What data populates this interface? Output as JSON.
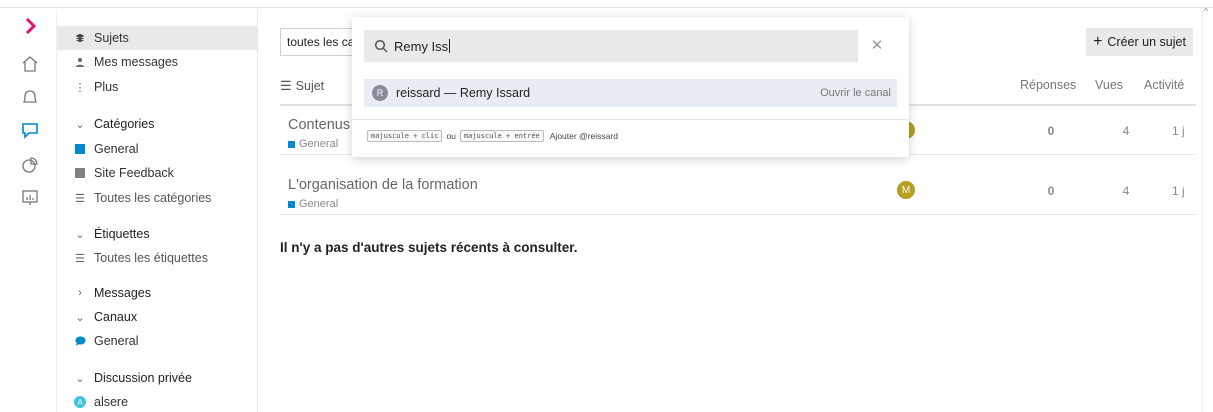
{
  "rail": {
    "items": [
      {
        "name": "expand-chevron-icon"
      },
      {
        "name": "home-icon"
      },
      {
        "name": "bell-icon"
      },
      {
        "name": "chat-icon"
      },
      {
        "name": "pie-chart-icon"
      },
      {
        "name": "presentation-icon"
      }
    ],
    "accent": "#e2136e",
    "active_color": "#0088cc"
  },
  "sidebar": {
    "sujets": "Sujets",
    "mes_messages": "Mes messages",
    "plus": "Plus",
    "categories_head": "Catégories",
    "cat_general": "General",
    "cat_site_feedback": "Site Feedback",
    "toutes_categories": "Toutes les catégories",
    "etiquettes_head": "Étiquettes",
    "toutes_etiquettes": "Toutes les étiquettes",
    "messages_head": "Messages",
    "canaux_head": "Canaux",
    "canal_general": "General",
    "discussion_head": "Discussion privée",
    "dm_user": "alsere",
    "dm_user_initial": "A"
  },
  "main": {
    "filter_text": "toutes les ca",
    "create_label": "Créer un sujet",
    "columns": {
      "subject": "Sujet",
      "replies": "Réponses",
      "views": "Vues",
      "activity": "Activité"
    },
    "topics": [
      {
        "title": "Contenus t",
        "category": "General",
        "avatar": "",
        "replies": "0",
        "views": "4",
        "activity": "1 j"
      },
      {
        "title": "L'organisation de la formation",
        "category": "General",
        "avatar": "M",
        "replies": "0",
        "views": "4",
        "activity": "1 j"
      }
    ],
    "no_more": "Il n'y a pas d'autres sujets récents à consulter."
  },
  "popup": {
    "query": "Remy Iss",
    "result_initial": "R",
    "result_label": "reissard — Remy Issard",
    "result_action": "Ouvrir le canal",
    "kbd1": "majuscule + clic",
    "or": "ou",
    "kbd2": "majuscule + entrée",
    "add_label": "Ajouter @reissard"
  }
}
